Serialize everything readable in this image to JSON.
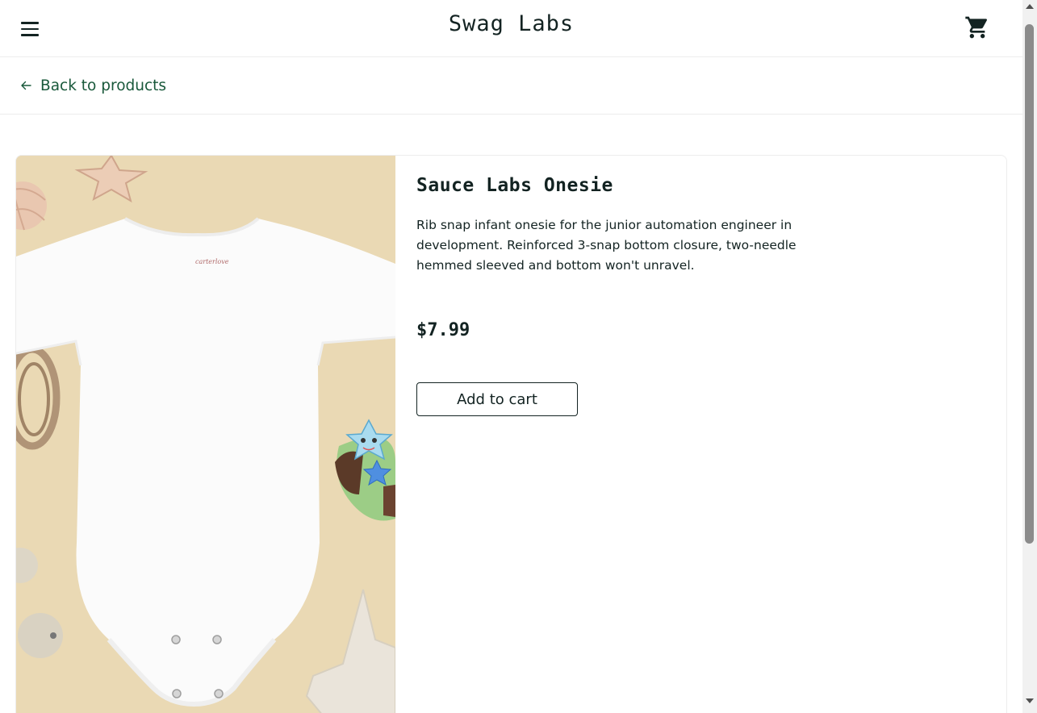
{
  "header": {
    "app_title": "Swag Labs",
    "menu_icon": "hamburger-menu-icon",
    "cart_icon": "shopping-cart-icon"
  },
  "subheader": {
    "back_label": "Back to products",
    "back_icon": "arrow-left-icon"
  },
  "product": {
    "name": "Sauce Labs Onesie",
    "description": "Rib snap infant onesie for the junior automation engineer in development. Reinforced 3-snap bottom closure, two-needle hemmed sleeved and bottom won't unravel.",
    "price": "$7.99",
    "add_to_cart_label": "Add to cart",
    "image_label_text": "carterlove"
  },
  "colors": {
    "brand_text": "#132322",
    "link_green": "#18583a",
    "image_background": "#ead9b4",
    "border": "#ededed"
  }
}
